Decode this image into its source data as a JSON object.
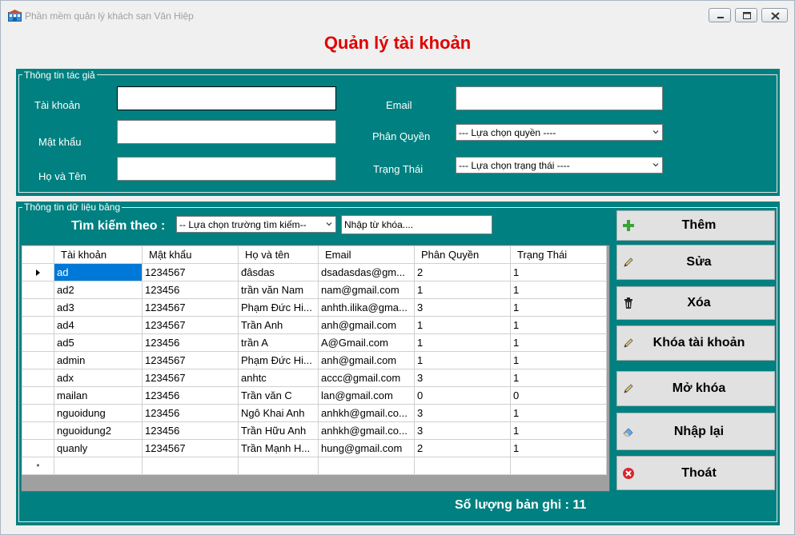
{
  "window": {
    "title": "Phần mềm quản lý khách sạn Vân Hiệp",
    "controls": {
      "minimize": "minimize-icon",
      "maximize": "maximize-icon",
      "close": "close-icon"
    }
  },
  "form_title": "Quản lý tài khoản",
  "account_info": {
    "legend": "Thông tin tác giả",
    "username_label": "Tài khoản",
    "username_value": "",
    "password_label": "Mật khẩu",
    "password_value": "",
    "fullname_label": "Họ và Tên",
    "fullname_value": "",
    "email_label": "Email",
    "email_value": "",
    "role_label": "Phân Quyền",
    "role_selected": "--- Lựa chọn quyền  ----",
    "status_label": "Trạng Thái",
    "status_selected": "--- Lựa chọn trạng thái  ----"
  },
  "data_section": {
    "legend": "Thông tin dữ liệu bảng",
    "search_label": "Tìm kiếm theo :",
    "search_field_selected": "-- Lựa chọn trường tìm kiếm--",
    "search_placeholder": "Nhập từ khóa...."
  },
  "table": {
    "columns": [
      "Tài khoản",
      "Mật khẩu",
      "Họ và tên",
      "Email",
      "Phân Quyền",
      "Trạng Thái"
    ],
    "rows": [
      [
        "ad",
        "1234567",
        "đâsdas",
        "dsadasdas@gm...",
        "2",
        "1"
      ],
      [
        "ad2",
        "123456",
        "trần văn Nam",
        "nam@gmail.com",
        "1",
        "1"
      ],
      [
        "ad3",
        "1234567",
        "Phạm Đức Hi...",
        "anhth.ilika@gma...",
        "3",
        "1"
      ],
      [
        "ad4",
        "1234567",
        "Trần Anh",
        "anh@gmail.com",
        "1",
        "1"
      ],
      [
        "ad5",
        "123456",
        "trần A",
        "A@Gmail.com",
        "1",
        "1"
      ],
      [
        "admin",
        "1234567",
        "Phạm Đức Hi...",
        "anh@gmail.com",
        "1",
        "1"
      ],
      [
        "adx",
        "1234567",
        "anhtc",
        "accc@gmail.com",
        "3",
        "1"
      ],
      [
        "mailan",
        "123456",
        "Trần văn C",
        "lan@gmail.com",
        "0",
        "0"
      ],
      [
        "nguoidung",
        "123456",
        "Ngô Khai Anh",
        "anhkh@gmail.co...",
        "3",
        "1"
      ],
      [
        "nguoidung2",
        "123456",
        "Trần Hữu Anh",
        "anhkh@gmail.co...",
        "3",
        "1"
      ],
      [
        "quanly",
        "1234567",
        "Trần Mạnh H...",
        "hung@gmail.com",
        "2",
        "1"
      ]
    ],
    "new_row_marker": "*"
  },
  "buttons": {
    "add": {
      "label": "Thêm",
      "icon": "plus-icon"
    },
    "edit": {
      "label": "Sửa",
      "icon": "pencil-icon"
    },
    "delete": {
      "label": "Xóa",
      "icon": "trash-icon"
    },
    "lock": {
      "label": "Khóa tài khoản",
      "icon": "pencil-icon"
    },
    "unlock": {
      "label": "Mở khóa",
      "icon": "pencil-icon"
    },
    "reset": {
      "label": "Nhập lại",
      "icon": "eraser-icon"
    },
    "exit": {
      "label": "Thoát",
      "icon": "close-circle-icon"
    }
  },
  "record_count": "Số lượng bản ghi : 11",
  "colors": {
    "panel": "#008080",
    "title": "#e00000",
    "selection": "#0078d7"
  }
}
